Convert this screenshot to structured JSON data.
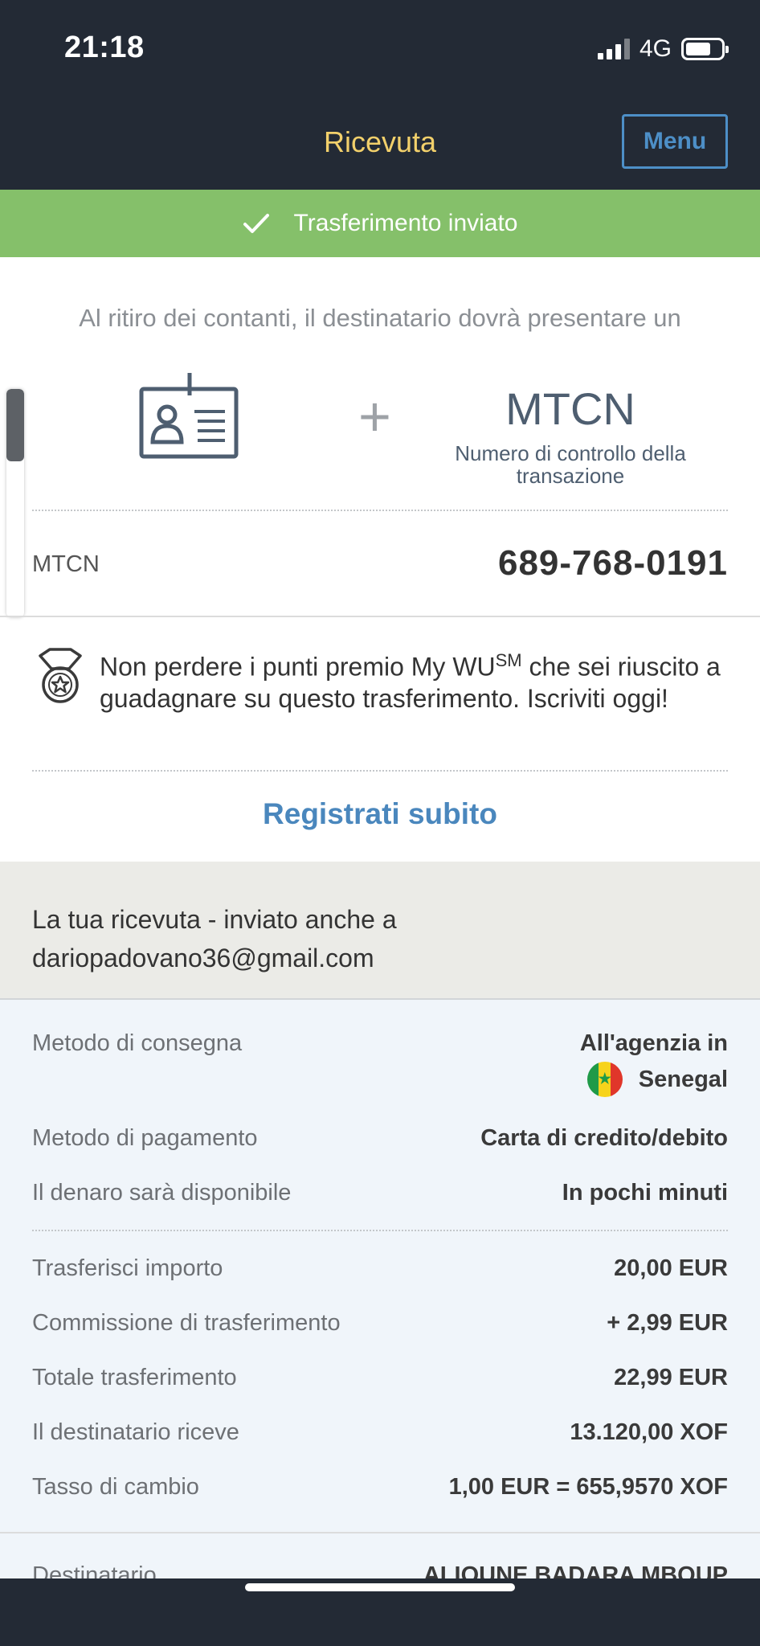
{
  "status_bar": {
    "time": "21:18",
    "network": "4G"
  },
  "header": {
    "title": "Ricevuta",
    "menu_label": "Menu"
  },
  "banner": {
    "text": "Trasferimento inviato"
  },
  "pickup": {
    "intro": "Al ritiro dei contanti, il destinatario dovrà presentare un",
    "plus": "+",
    "mtcn_title": "MTCN",
    "mtcn_subtitle": "Numero di controllo della transazione"
  },
  "mtcn_row": {
    "label": "MTCN",
    "value": "689-768-0191"
  },
  "promo": {
    "text_before": "Non perdere i punti premio My WU",
    "superscript": "SM",
    "text_after": " che sei riuscito a guadagnare su questo trasferimento. Iscriviti oggi!",
    "link": "Registrati subito"
  },
  "receipt": {
    "line1": "La tua ricevuta - inviato anche a",
    "line2": "dariopadovano36@gmail.com"
  },
  "details": {
    "delivery_label": "Metodo di consegna",
    "delivery_value_1": "All'agenzia in",
    "delivery_value_2": "Senegal",
    "payment_label": "Metodo di pagamento",
    "payment_value": "Carta di credito/debito",
    "availability_label": "Il denaro sarà disponibile",
    "availability_value": "In pochi minuti",
    "amount_label": "Trasferisci importo",
    "amount_value": "20,00 EUR",
    "fee_label": "Commissione di trasferimento",
    "fee_value": "+ 2,99 EUR",
    "total_label": "Totale trasferimento",
    "total_value": "22,99 EUR",
    "receives_label": "Il destinatario riceve",
    "receives_value": "13.120,00 XOF",
    "rate_label": "Tasso di cambio",
    "rate_value": "1,00 EUR = 655,9570 XOF",
    "recipient_label": "Destinatario",
    "recipient_value": "ALIOUNE BADARA MBOUP"
  },
  "colors": {
    "dark": "#232a35",
    "title_yellow": "#f2d06b",
    "accent_blue": "#4a87bd",
    "success_green": "#85c06a"
  }
}
